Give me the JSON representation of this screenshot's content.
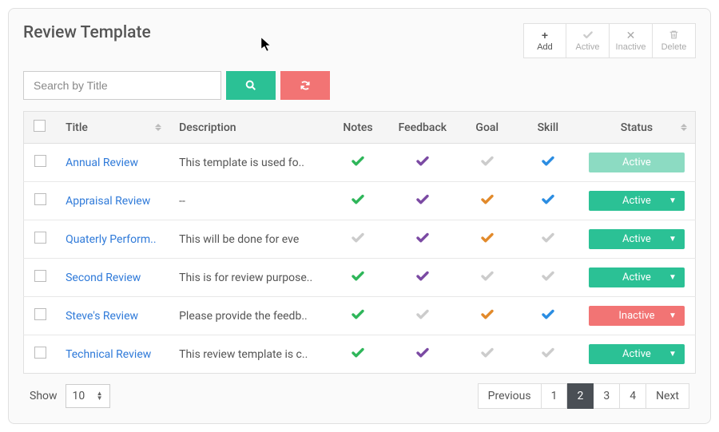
{
  "page_title": "Review Template",
  "actions": {
    "add": "Add",
    "active": "Active",
    "inactive": "Inactive",
    "delete": "Delete"
  },
  "search": {
    "placeholder": "Search by Title"
  },
  "columns": {
    "title": "Title",
    "description": "Description",
    "notes": "Notes",
    "feedback": "Feedback",
    "goal": "Goal",
    "skill": "Skill",
    "status": "Status"
  },
  "rows": [
    {
      "title": "Annual Review",
      "description": "This template is used fo..",
      "notes": "green",
      "feedback": "purple",
      "goal": "gray",
      "skill": "blue",
      "status": "Active",
      "status_style": "light"
    },
    {
      "title": "Appraisal Review",
      "description": "--",
      "notes": "green",
      "feedback": "purple",
      "goal": "orange",
      "skill": "blue",
      "status": "Active",
      "status_style": "active"
    },
    {
      "title": "Quaterly Perform..",
      "description": "This will be done for eve",
      "notes": "gray",
      "feedback": "purple",
      "goal": "orange",
      "skill": "gray",
      "status": "Active",
      "status_style": "active"
    },
    {
      "title": "Second Review",
      "description": "This is for review purpose..",
      "notes": "green",
      "feedback": "purple",
      "goal": "gray",
      "skill": "gray",
      "status": "Active",
      "status_style": "active"
    },
    {
      "title": "Steve's Review",
      "description": "Please provide the feedb..",
      "notes": "green",
      "feedback": "gray",
      "goal": "orange",
      "skill": "blue",
      "status": "Inactive",
      "status_style": "inactive"
    },
    {
      "title": "Technical Review",
      "description": "This review template is c..",
      "notes": "green",
      "feedback": "purple",
      "goal": "gray",
      "skill": "gray",
      "status": "Active",
      "status_style": "active"
    }
  ],
  "footer": {
    "show_label": "Show",
    "page_size": "10",
    "previous": "Previous",
    "next": "Next",
    "pages": [
      "1",
      "2",
      "3",
      "4"
    ],
    "current_page": "2"
  }
}
